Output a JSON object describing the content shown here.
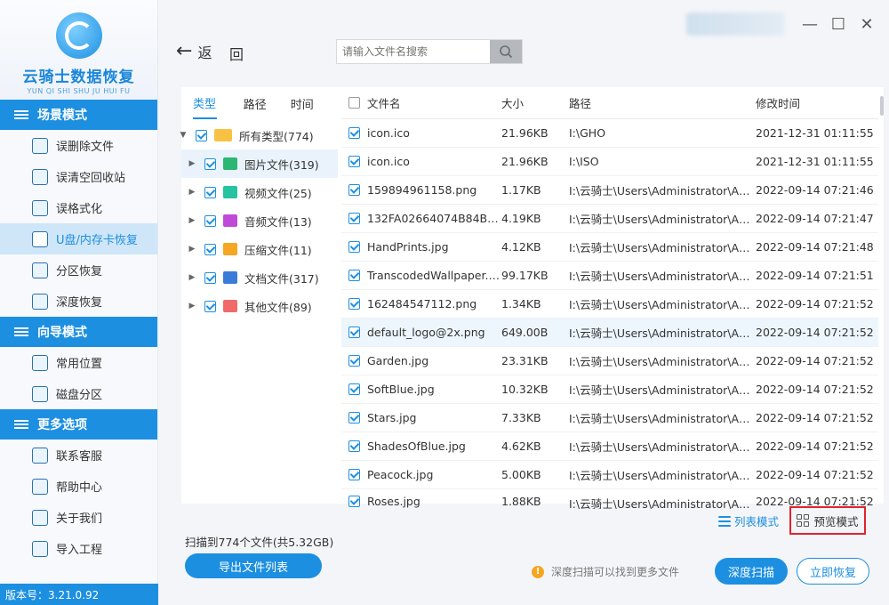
{
  "app": {
    "title": "云骑士数据恢复",
    "subtitle": "YUN QI SHI SHU JU HUI FU",
    "version": "版本号：3.21.0.92",
    "accent": "#1d8fe1"
  },
  "sidebar": {
    "sections": [
      {
        "title": "场景模式",
        "icon": "monitor-icon",
        "items": [
          {
            "label": "误删除文件",
            "icon": "deleted-file-icon"
          },
          {
            "label": "误清空回收站",
            "icon": "recycle-bin-icon"
          },
          {
            "label": "误格式化",
            "icon": "format-icon"
          },
          {
            "label": "U盘/内存卡恢复",
            "icon": "usb-drive-icon",
            "active": true
          },
          {
            "label": "分区恢复",
            "icon": "partition-icon"
          },
          {
            "label": "深度恢复",
            "icon": "deep-recovery-icon"
          }
        ]
      },
      {
        "title": "向导模式",
        "icon": "signpost-icon",
        "items": [
          {
            "label": "常用位置",
            "icon": "windows-icon"
          },
          {
            "label": "磁盘分区",
            "icon": "disk-icon"
          }
        ]
      },
      {
        "title": "更多选项",
        "icon": "menu-icon",
        "items": [
          {
            "label": "联系客服",
            "icon": "phone-icon"
          },
          {
            "label": "帮助中心",
            "icon": "help-icon"
          },
          {
            "label": "关于我们",
            "icon": "info-icon"
          },
          {
            "label": "导入工程",
            "icon": "import-icon"
          }
        ]
      }
    ]
  },
  "toolbar": {
    "back_label": "返",
    "back_label2": "回",
    "search_placeholder": "请输入文件名搜索"
  },
  "tabs": [
    {
      "label": "类型",
      "active": true
    },
    {
      "label": "路径"
    },
    {
      "label": "时间"
    }
  ],
  "tree": {
    "root": {
      "label": "所有类型(774)",
      "icon": "folder-icon"
    },
    "children": [
      {
        "label": "图片文件(319)",
        "icon": "image-icon",
        "color": "#2bb673",
        "selected": true
      },
      {
        "label": "视频文件(25)",
        "icon": "video-icon",
        "color": "#27c2a0"
      },
      {
        "label": "音频文件(13)",
        "icon": "audio-icon",
        "color": "#c04ad8"
      },
      {
        "label": "压缩文件(11)",
        "icon": "archive-icon",
        "color": "#f5a623"
      },
      {
        "label": "文档文件(317)",
        "icon": "document-icon",
        "color": "#3b7bd8"
      },
      {
        "label": "其他文件(89)",
        "icon": "other-icon",
        "color": "#f06a6a"
      }
    ]
  },
  "table": {
    "columns": [
      "文件名",
      "大小",
      "路径",
      "修改时间"
    ],
    "rows": [
      {
        "name": "icon.ico",
        "size": "21.96KB",
        "path": "I:\\GHO",
        "time": "2021-12-31 01:11:55"
      },
      {
        "name": "icon.ico",
        "size": "21.96KB",
        "path": "I:\\ISO",
        "time": "2021-12-31 01:11:55"
      },
      {
        "name": "159894961158.png",
        "size": "1.17KB",
        "path": "I:\\云骑士\\Users\\Administrator\\Ap...",
        "time": "2022-09-14 07:21:46"
      },
      {
        "name": "132FA02664074B84BF67...",
        "size": "4.19KB",
        "path": "I:\\云骑士\\Users\\Administrator\\Ap...",
        "time": "2022-09-14 07:21:47"
      },
      {
        "name": "HandPrints.jpg",
        "size": "4.12KB",
        "path": "I:\\云骑士\\Users\\Administrator\\Ap...",
        "time": "2022-09-14 07:21:48"
      },
      {
        "name": "TranscodedWallpaper.j...",
        "size": "99.17KB",
        "path": "I:\\云骑士\\Users\\Administrator\\Ap...",
        "time": "2022-09-14 07:21:51"
      },
      {
        "name": "162484547112.png",
        "size": "1.34KB",
        "path": "I:\\云骑士\\Users\\Administrator\\Ap...",
        "time": "2022-09-14 07:21:52"
      },
      {
        "name": "default_logo@2x.png",
        "size": "649.00B",
        "path": "I:\\云骑士\\Users\\Administrator\\Ap...",
        "time": "2022-09-14 07:21:52",
        "highlight": true
      },
      {
        "name": "Garden.jpg",
        "size": "23.31KB",
        "path": "I:\\云骑士\\Users\\Administrator\\Ap...",
        "time": "2022-09-14 07:21:52"
      },
      {
        "name": "SoftBlue.jpg",
        "size": "10.32KB",
        "path": "I:\\云骑士\\Users\\Administrator\\Ap...",
        "time": "2022-09-14 07:21:52"
      },
      {
        "name": "Stars.jpg",
        "size": "7.33KB",
        "path": "I:\\云骑士\\Users\\Administrator\\Ap...",
        "time": "2022-09-14 07:21:52"
      },
      {
        "name": "ShadesOfBlue.jpg",
        "size": "4.62KB",
        "path": "I:\\云骑士\\Users\\Administrator\\Ap...",
        "time": "2022-09-14 07:21:52"
      },
      {
        "name": "Peacock.jpg",
        "size": "5.00KB",
        "path": "I:\\云骑士\\Users\\Administrator\\Ap...",
        "time": "2022-09-14 07:21:52"
      },
      {
        "name": "Roses.jpg",
        "size": "1.88KB",
        "path": "I:\\云骑士\\Users\\Administrator\\Ap...",
        "time": "2022-09-14 07:21:52"
      }
    ]
  },
  "view": {
    "list_mode": "列表模式",
    "preview_mode": "预览模式"
  },
  "footer": {
    "scan_summary": "扫描到774个文件(共5.32GB)",
    "export_label": "导出文件列表",
    "hint": "深度扫描可以找到更多文件",
    "deep_scan_label": "深度扫描",
    "recover_label": "立即恢复"
  }
}
